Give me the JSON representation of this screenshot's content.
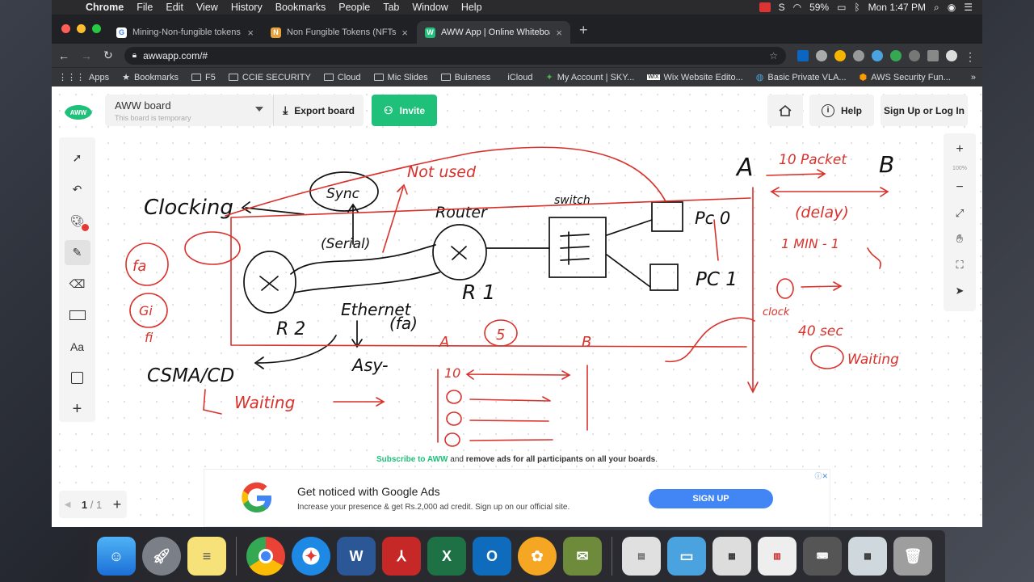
{
  "menubar": {
    "app": "Chrome",
    "items": [
      "File",
      "Edit",
      "View",
      "History",
      "Bookmarks",
      "People",
      "Tab",
      "Window",
      "Help"
    ],
    "battery": "59%",
    "clock": "Mon 1:47 PM"
  },
  "tabs": [
    {
      "title": "Mining-Non-fungible tokens -",
      "favicon": "G"
    },
    {
      "title": "Non Fungible Tokens (NFTs): A",
      "favicon": "N"
    },
    {
      "title": "AWW App | Online Whiteboard",
      "favicon": "W",
      "active": true
    }
  ],
  "address": {
    "url": "awwapp.com/#"
  },
  "bookmarks": [
    "Apps",
    "Bookmarks",
    "F5",
    "CCIE SECURITY",
    "Cloud",
    "Mic Slides",
    "Buisness",
    "iCloud",
    "My Account | SKY...",
    "Wix Website Edito...",
    "Basic Private VLA...",
    "AWS Security Fun..."
  ],
  "aww": {
    "logo_text": "AWW",
    "board_name": "AWW board",
    "board_sub": "This board is temporary",
    "export": "Export board",
    "invite": "Invite",
    "help": "Help",
    "signup": "Sign Up or Log In",
    "zoom": "100%",
    "page_current": "1",
    "page_total": "/ 1",
    "tools": {
      "text_tool": "Aa"
    }
  },
  "drawing_text": {
    "clocking": "Clocking",
    "sync": "Sync",
    "not_used": "Not used",
    "router": "Router",
    "switch": "switch",
    "pc0": "Pc 0",
    "pc1": "PC 1",
    "serial": "(Serial)",
    "r1": "R 1",
    "r2": "R 2",
    "ethernet": "Ethernet",
    "fa": "(fa)",
    "async": "Asy-",
    "csma": "CSMA/CD",
    "fa_circle": "fa",
    "gi": "Gi",
    "fi": "fi",
    "a_label": "A",
    "b_label": "B",
    "ten_packet": "10 Packet",
    "delay": "(delay)",
    "one_min": "1 MIN - 1",
    "forty_sec": "40 sec",
    "waiting": "Waiting",
    "clock": "clock",
    "a_small": "A",
    "b_small": "B",
    "five": "5",
    "ten": "10",
    "waiting_left": "Waiting"
  },
  "subscribe": {
    "link": "Subscribe to AWW",
    "mid": " and ",
    "bold": "remove ads for all participants on all your boards",
    "end": "."
  },
  "ad": {
    "headline": "Get noticed with Google Ads",
    "body": "Increase your presence & get Rs.2,000 ad credit. Sign up on our official site.",
    "cta": "SIGN UP",
    "adchoices": "ⓘ✕"
  },
  "colors": {
    "accent": "#1fc07a",
    "ink_red": "#d9312b",
    "ink_black": "#111111",
    "google_blue": "#4285f4"
  }
}
